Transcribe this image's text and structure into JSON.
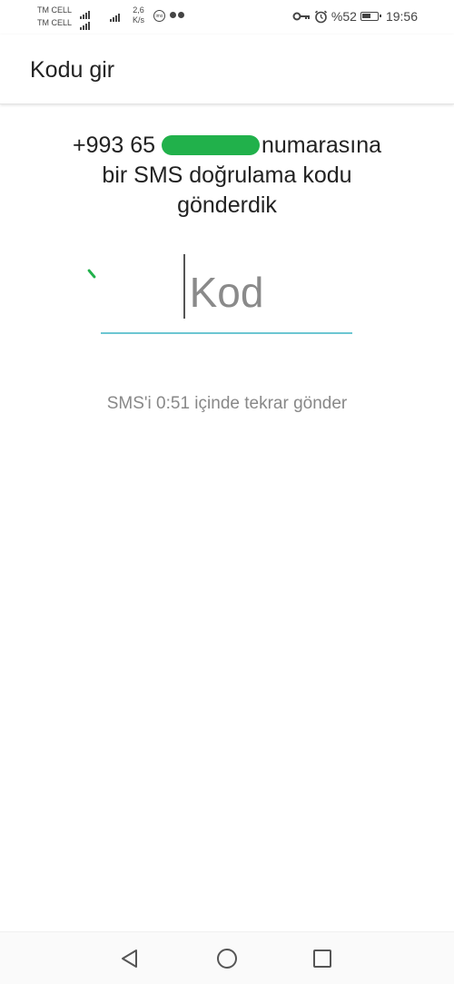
{
  "status_bar": {
    "carrier_1": "TM CELL",
    "carrier_2": "TM CELL",
    "speed_value": "2,6",
    "speed_unit": "K/s",
    "imo_label": "imo",
    "battery": "%52",
    "time": "19:56"
  },
  "app_bar": {
    "title": "Kodu gir"
  },
  "message": {
    "phone_prefix": "+993 65",
    "line1_suffix": "numarasına",
    "line2": "bir SMS doğrulama kodu",
    "line3": "gönderdik"
  },
  "code_input": {
    "placeholder": "Kod",
    "value": ""
  },
  "resend": {
    "text": "SMS'i 0:51 içinde tekrar gönder"
  },
  "colors": {
    "accent_underline": "#6cc6d2",
    "redaction": "#21b14b"
  },
  "icons": {
    "key": "key-icon",
    "alarm": "alarm-icon",
    "battery": "battery-icon",
    "nav_back": "back-triangle-icon",
    "nav_home": "home-circle-icon",
    "nav_recent": "recent-square-icon"
  }
}
